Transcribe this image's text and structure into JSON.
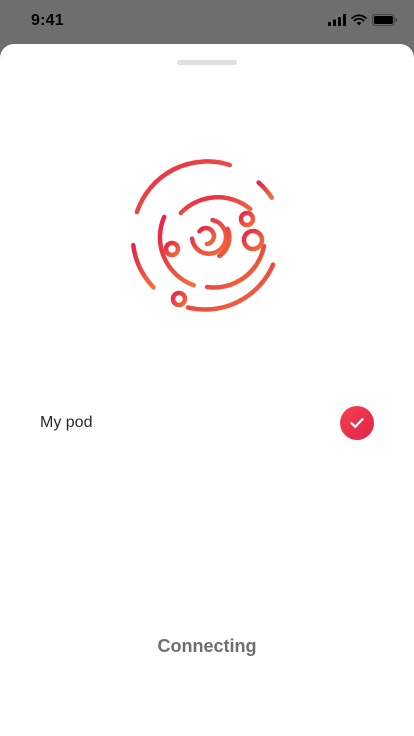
{
  "status_bar": {
    "time": "9:41",
    "icons": [
      "signal-icon",
      "wifi-icon",
      "battery-icon"
    ]
  },
  "sheet": {
    "illustration": "orbit-icon",
    "device": {
      "name": "My pod",
      "selected": true,
      "badge_icon": "checkmark-icon"
    },
    "status": "Connecting"
  },
  "colors": {
    "accent_start": "#e4244a",
    "accent_end": "#f2703a",
    "status_text": "#6f6f73"
  }
}
